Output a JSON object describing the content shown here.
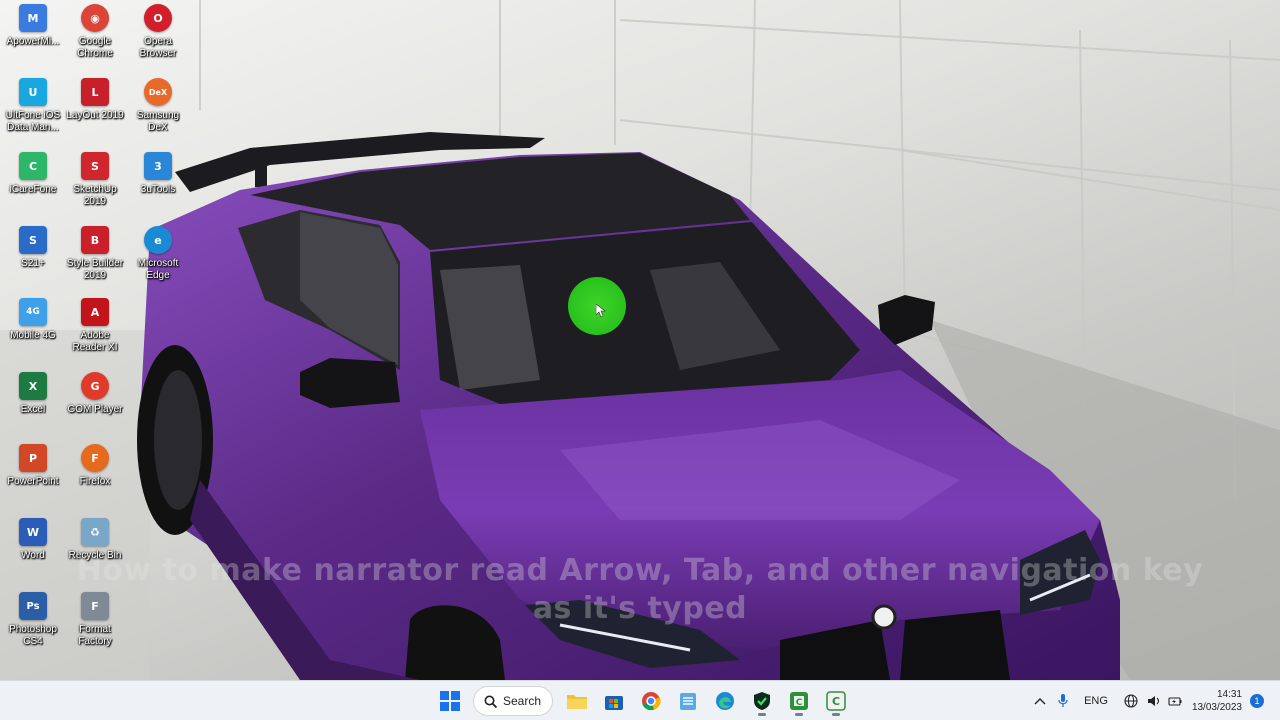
{
  "desktop_icons": [
    {
      "name": "apowermirror-icon",
      "label": "ApowerMi...",
      "glyph": "M",
      "color": "#3a7be0"
    },
    {
      "name": "ultfone-ios-icon",
      "label": "UltFone iOS\nData Man...",
      "glyph": "U",
      "color": "#19a7e0"
    },
    {
      "name": "icarefone-icon",
      "label": "iCareFone",
      "glyph": "C",
      "color": "#2db56a"
    },
    {
      "name": "s21-plus-icon",
      "label": "S21+",
      "glyph": "S",
      "color": "#2a6ac9"
    },
    {
      "name": "mobile-4g-icon",
      "label": "Mobile 4G",
      "glyph": "4G",
      "color": "#3da0e8"
    },
    {
      "name": "excel-icon",
      "label": "Excel",
      "glyph": "X",
      "color": "#1e7a43"
    },
    {
      "name": "powerpoint-icon",
      "label": "PowerPoint",
      "glyph": "P",
      "color": "#d24726"
    },
    {
      "name": "word-icon",
      "label": "Word",
      "glyph": "W",
      "color": "#2b5cb8"
    },
    {
      "name": "photoshop-icon",
      "label": "Photoshop\nCS4",
      "glyph": "Ps",
      "color": "#2a5fa8"
    },
    {
      "name": "google-chrome-icon",
      "label": "Google\nChrome",
      "glyph": "◉",
      "color": "#db4437"
    },
    {
      "name": "layout-2019-icon",
      "label": "LayOut 2019",
      "glyph": "L",
      "color": "#c8202a"
    },
    {
      "name": "sketchup-2019-icon",
      "label": "SketchUp\n2019",
      "glyph": "S",
      "color": "#d0262e"
    },
    {
      "name": "style-builder-icon",
      "label": "Style Builder\n2019",
      "glyph": "B",
      "color": "#c9202a"
    },
    {
      "name": "adobe-reader-icon",
      "label": "Adobe\nReader XI",
      "glyph": "A",
      "color": "#c4141b"
    },
    {
      "name": "gom-player-icon",
      "label": "GOM Player",
      "glyph": "G",
      "color": "#e03b2a"
    },
    {
      "name": "firefox-icon",
      "label": "Firefox",
      "glyph": "F",
      "color": "#e66a1d"
    },
    {
      "name": "recycle-bin-icon",
      "label": "Recycle Bin",
      "glyph": "♻",
      "color": "#7aa6c8"
    },
    {
      "name": "format-factory-icon",
      "label": "Format\nFactory",
      "glyph": "F",
      "color": "#7e8a96"
    },
    {
      "name": "opera-browser-icon",
      "label": "Opera\nBrowser",
      "glyph": "O",
      "color": "#d21f2c"
    },
    {
      "name": "samsung-dex-icon",
      "label": "Samsung\nDeX",
      "glyph": "DeX",
      "color": "#e86a2a"
    },
    {
      "name": "3utools-icon",
      "label": "3uTools",
      "glyph": "3",
      "color": "#2a86d6"
    },
    {
      "name": "microsoft-edge-icon",
      "label": "Microsoft\nEdge",
      "glyph": "e",
      "color": "#1a8ad4"
    }
  ],
  "subtitle": {
    "line1": "How to make narrator read Arrow, Tab, and other navigation key",
    "line2": "as it's typed"
  },
  "taskbar": {
    "search_label": "Search",
    "language": "ENG",
    "time": "14:31",
    "date": "13/03/2023",
    "notifications": "1"
  },
  "colors": {
    "car_body": "#5a2a86",
    "car_body_highlight": "#8a4fc0",
    "taskbar_bg": "#eef1f6",
    "cursor_highlight": "#2cc41f"
  }
}
